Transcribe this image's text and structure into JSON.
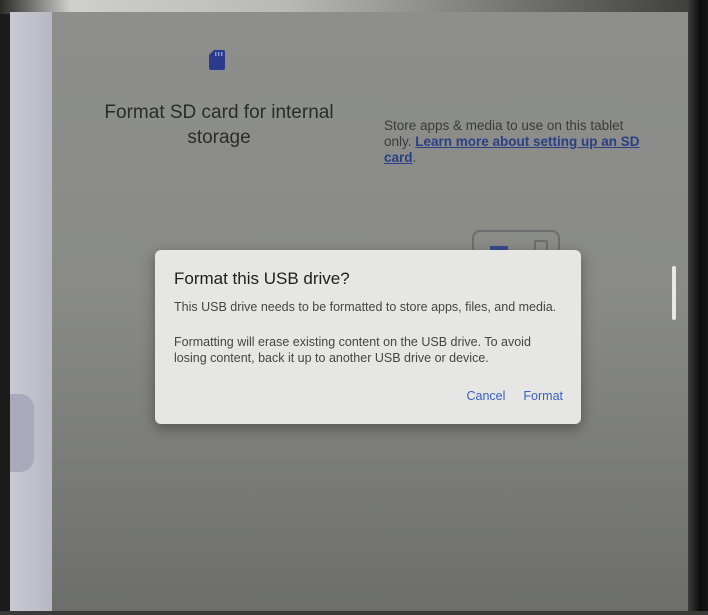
{
  "setup": {
    "icon": "sd-card-icon",
    "title": "Format SD card for internal storage",
    "description_text": "Store apps & media to use on this tablet only. ",
    "learn_more_link": "Learn more about setting up an SD card",
    "description_end": "."
  },
  "dialog": {
    "title": "Format this USB drive?",
    "message_1": "This USB drive needs to be formatted to store apps, files, and media.",
    "message_2": "Formatting will erase existing content on the USB drive. To avoid losing content, back it up to another USB drive or device.",
    "cancel_label": "Cancel",
    "format_label": "Format"
  },
  "colors": {
    "accent": "#3a5ec9",
    "sd_icon": "#2b3a8c"
  }
}
